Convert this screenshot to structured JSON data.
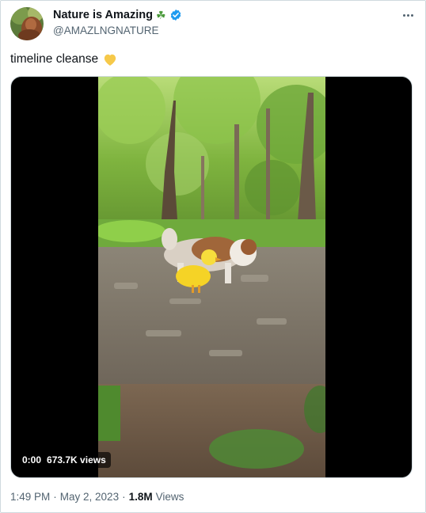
{
  "author": {
    "display_name": "Nature is Amazing",
    "handle": "@AMAZLNGNATURE",
    "name_emoji": "☘️",
    "verified_icon": "verified-badge-icon",
    "avatar_icon": "avatar-portrait"
  },
  "tweet": {
    "text": "timeline cleanse",
    "emoji": "💛"
  },
  "video": {
    "time": "0:00",
    "views_label": "673.7K views"
  },
  "footer": {
    "time": "1:49 PM",
    "sep1": "·",
    "date": "May 2, 2023",
    "sep2": "·",
    "views_count": "1.8M",
    "views_word": "Views"
  },
  "colors": {
    "text_primary": "#0f1419",
    "text_secondary": "#536471",
    "verified_blue": "#1d9bf0",
    "border": "#cfd9de"
  }
}
